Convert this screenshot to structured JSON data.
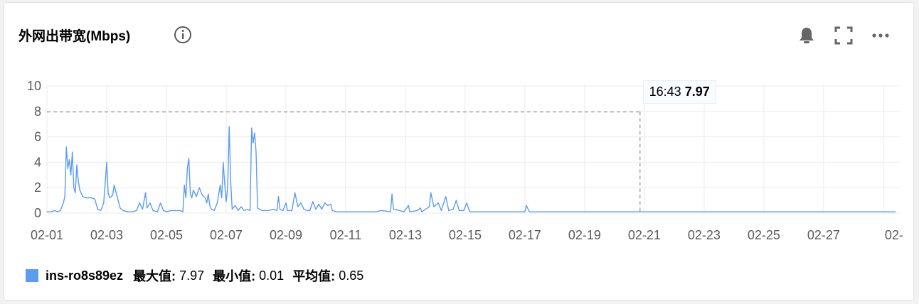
{
  "panel": {
    "title": "外网出带宽(Mbps)",
    "icons": [
      "info-icon",
      "bell-icon",
      "fullscreen-icon",
      "more-icon"
    ]
  },
  "colors": {
    "series": "#5b9cf2",
    "grid": "#ebebeb",
    "axis_text": "#5a5a5a",
    "max_line": "#bbbbbb"
  },
  "legend": {
    "series_name": "ins-ro8s89ez",
    "max_label": "最大值:",
    "max_value": "7.97",
    "min_label": "最小值:",
    "min_value": "0.01",
    "avg_label": "平均值:",
    "avg_value": "0.65"
  },
  "tooltip": {
    "time": "16:43",
    "value": "7.97"
  },
  "chart_data": {
    "type": "line",
    "xlabel": "",
    "ylabel": "",
    "ylim": [
      0,
      10
    ],
    "yticks": [
      "0",
      "2",
      "4",
      "6",
      "8",
      "10"
    ],
    "xticks": [
      "02-01",
      "02-03",
      "02-05",
      "02-07",
      "02-09",
      "02-11",
      "02-13",
      "02-15",
      "02-17",
      "02-19",
      "02-21",
      "02-23",
      "02-25",
      "02-27",
      "02-"
    ],
    "x_range_days": [
      0,
      28.55
    ],
    "grid": true,
    "max_marker": {
      "x": 19.85,
      "y": 7.97
    },
    "series": [
      {
        "name": "ins-ro8s89ez",
        "points": [
          [
            0.0,
            0.1
          ],
          [
            0.15,
            0.1
          ],
          [
            0.25,
            0.2
          ],
          [
            0.35,
            0.1
          ],
          [
            0.45,
            0.2
          ],
          [
            0.55,
            0.8
          ],
          [
            0.6,
            1.3
          ],
          [
            0.65,
            5.2
          ],
          [
            0.7,
            3.5
          ],
          [
            0.75,
            4.2
          ],
          [
            0.8,
            3.0
          ],
          [
            0.85,
            4.8
          ],
          [
            0.9,
            2.0
          ],
          [
            0.95,
            1.6
          ],
          [
            1.0,
            3.8
          ],
          [
            1.05,
            2.5
          ],
          [
            1.1,
            1.8
          ],
          [
            1.2,
            1.3
          ],
          [
            1.3,
            1.2
          ],
          [
            1.4,
            1.2
          ],
          [
            1.5,
            1.2
          ],
          [
            1.6,
            1.1
          ],
          [
            1.7,
            0.3
          ],
          [
            1.8,
            0.2
          ],
          [
            1.9,
            0.8
          ],
          [
            2.0,
            4.0
          ],
          [
            2.05,
            1.6
          ],
          [
            2.1,
            1.2
          ],
          [
            2.2,
            1.4
          ],
          [
            2.25,
            2.2
          ],
          [
            2.35,
            1.3
          ],
          [
            2.45,
            0.4
          ],
          [
            2.55,
            0.2
          ],
          [
            2.7,
            0.1
          ],
          [
            2.85,
            0.1
          ],
          [
            3.0,
            0.2
          ],
          [
            3.1,
            0.8
          ],
          [
            3.2,
            0.3
          ],
          [
            3.3,
            1.6
          ],
          [
            3.35,
            0.4
          ],
          [
            3.45,
            0.8
          ],
          [
            3.55,
            0.2
          ],
          [
            3.7,
            0.1
          ],
          [
            3.8,
            0.8
          ],
          [
            3.9,
            0.2
          ],
          [
            4.0,
            0.1
          ],
          [
            4.15,
            0.2
          ],
          [
            4.3,
            0.2
          ],
          [
            4.45,
            0.2
          ],
          [
            4.55,
            0.1
          ],
          [
            4.6,
            2.2
          ],
          [
            4.65,
            1.2
          ],
          [
            4.7,
            3.5
          ],
          [
            4.75,
            4.3
          ],
          [
            4.8,
            1.5
          ],
          [
            4.85,
            1.2
          ],
          [
            4.9,
            1.8
          ],
          [
            5.0,
            1.3
          ],
          [
            5.1,
            2.0
          ],
          [
            5.2,
            1.4
          ],
          [
            5.3,
            1.2
          ],
          [
            5.35,
            0.8
          ],
          [
            5.4,
            1.5
          ],
          [
            5.45,
            0.6
          ],
          [
            5.5,
            0.3
          ],
          [
            5.6,
            0.2
          ],
          [
            5.7,
            0.8
          ],
          [
            5.75,
            1.5
          ],
          [
            5.8,
            2.2
          ],
          [
            5.85,
            1.2
          ],
          [
            5.9,
            4.0
          ],
          [
            5.95,
            2.3
          ],
          [
            6.0,
            0.9
          ],
          [
            6.05,
            2.0
          ],
          [
            6.1,
            6.8
          ],
          [
            6.15,
            2.5
          ],
          [
            6.2,
            0.3
          ],
          [
            6.3,
            0.6
          ],
          [
            6.4,
            0.2
          ],
          [
            6.5,
            0.5
          ],
          [
            6.6,
            0.2
          ],
          [
            6.7,
            0.3
          ],
          [
            6.8,
            0.2
          ],
          [
            6.85,
            6.7
          ],
          [
            6.9,
            5.5
          ],
          [
            6.95,
            6.3
          ],
          [
            7.0,
            4.8
          ],
          [
            7.05,
            0.4
          ],
          [
            7.2,
            0.2
          ],
          [
            7.4,
            0.2
          ],
          [
            7.6,
            0.3
          ],
          [
            7.7,
            0.2
          ],
          [
            7.75,
            1.3
          ],
          [
            7.8,
            0.3
          ],
          [
            7.9,
            0.2
          ],
          [
            8.0,
            0.8
          ],
          [
            8.05,
            0.2
          ],
          [
            8.2,
            0.2
          ],
          [
            8.3,
            1.6
          ],
          [
            8.4,
            0.5
          ],
          [
            8.5,
            0.8
          ],
          [
            8.6,
            0.3
          ],
          [
            8.7,
            0.2
          ],
          [
            8.8,
            0.2
          ],
          [
            8.9,
            0.9
          ],
          [
            9.0,
            0.3
          ],
          [
            9.1,
            0.7
          ],
          [
            9.2,
            0.3
          ],
          [
            9.3,
            0.8
          ],
          [
            9.4,
            0.6
          ],
          [
            9.5,
            0.7
          ],
          [
            9.55,
            0.2
          ],
          [
            9.7,
            0.1
          ],
          [
            10.0,
            0.1
          ],
          [
            10.5,
            0.1
          ],
          [
            11.0,
            0.1
          ],
          [
            11.2,
            0.2
          ],
          [
            11.5,
            0.1
          ],
          [
            11.55,
            1.5
          ],
          [
            11.6,
            0.3
          ],
          [
            11.8,
            0.2
          ],
          [
            11.95,
            0.1
          ],
          [
            12.1,
            0.6
          ],
          [
            12.15,
            0.1
          ],
          [
            12.4,
            0.2
          ],
          [
            12.5,
            0.4
          ],
          [
            12.55,
            0.1
          ],
          [
            12.8,
            0.5
          ],
          [
            12.85,
            1.6
          ],
          [
            12.95,
            0.5
          ],
          [
            13.1,
            0.8
          ],
          [
            13.2,
            0.2
          ],
          [
            13.35,
            1.3
          ],
          [
            13.45,
            0.2
          ],
          [
            13.6,
            0.3
          ],
          [
            13.7,
            1.0
          ],
          [
            13.8,
            0.2
          ],
          [
            13.95,
            0.2
          ],
          [
            14.05,
            0.8
          ],
          [
            14.15,
            0.1
          ],
          [
            14.4,
            0.1
          ],
          [
            14.8,
            0.1
          ],
          [
            15.2,
            0.1
          ],
          [
            15.6,
            0.1
          ],
          [
            16.0,
            0.1
          ],
          [
            16.05,
            0.6
          ],
          [
            16.15,
            0.1
          ],
          [
            16.4,
            0.1
          ],
          [
            16.8,
            0.1
          ],
          [
            17.2,
            0.1
          ],
          [
            17.6,
            0.1
          ],
          [
            18.0,
            0.1
          ],
          [
            18.4,
            0.1
          ],
          [
            18.8,
            0.1
          ],
          [
            19.2,
            0.1
          ],
          [
            19.6,
            0.1
          ],
          [
            20.0,
            0.1
          ],
          [
            20.4,
            0.1
          ],
          [
            20.8,
            0.1
          ],
          [
            21.2,
            0.1
          ],
          [
            21.6,
            0.1
          ],
          [
            22.0,
            0.1
          ],
          [
            22.4,
            0.1
          ],
          [
            22.8,
            0.1
          ],
          [
            23.2,
            0.1
          ],
          [
            23.6,
            0.1
          ],
          [
            24.0,
            0.1
          ],
          [
            24.4,
            0.1
          ],
          [
            24.8,
            0.1
          ],
          [
            25.2,
            0.1
          ],
          [
            25.6,
            0.1
          ],
          [
            26.0,
            0.1
          ],
          [
            26.4,
            0.1
          ],
          [
            26.8,
            0.1
          ],
          [
            27.2,
            0.1
          ],
          [
            27.6,
            0.1
          ],
          [
            28.0,
            0.1
          ],
          [
            28.4,
            0.1
          ]
        ]
      }
    ]
  }
}
